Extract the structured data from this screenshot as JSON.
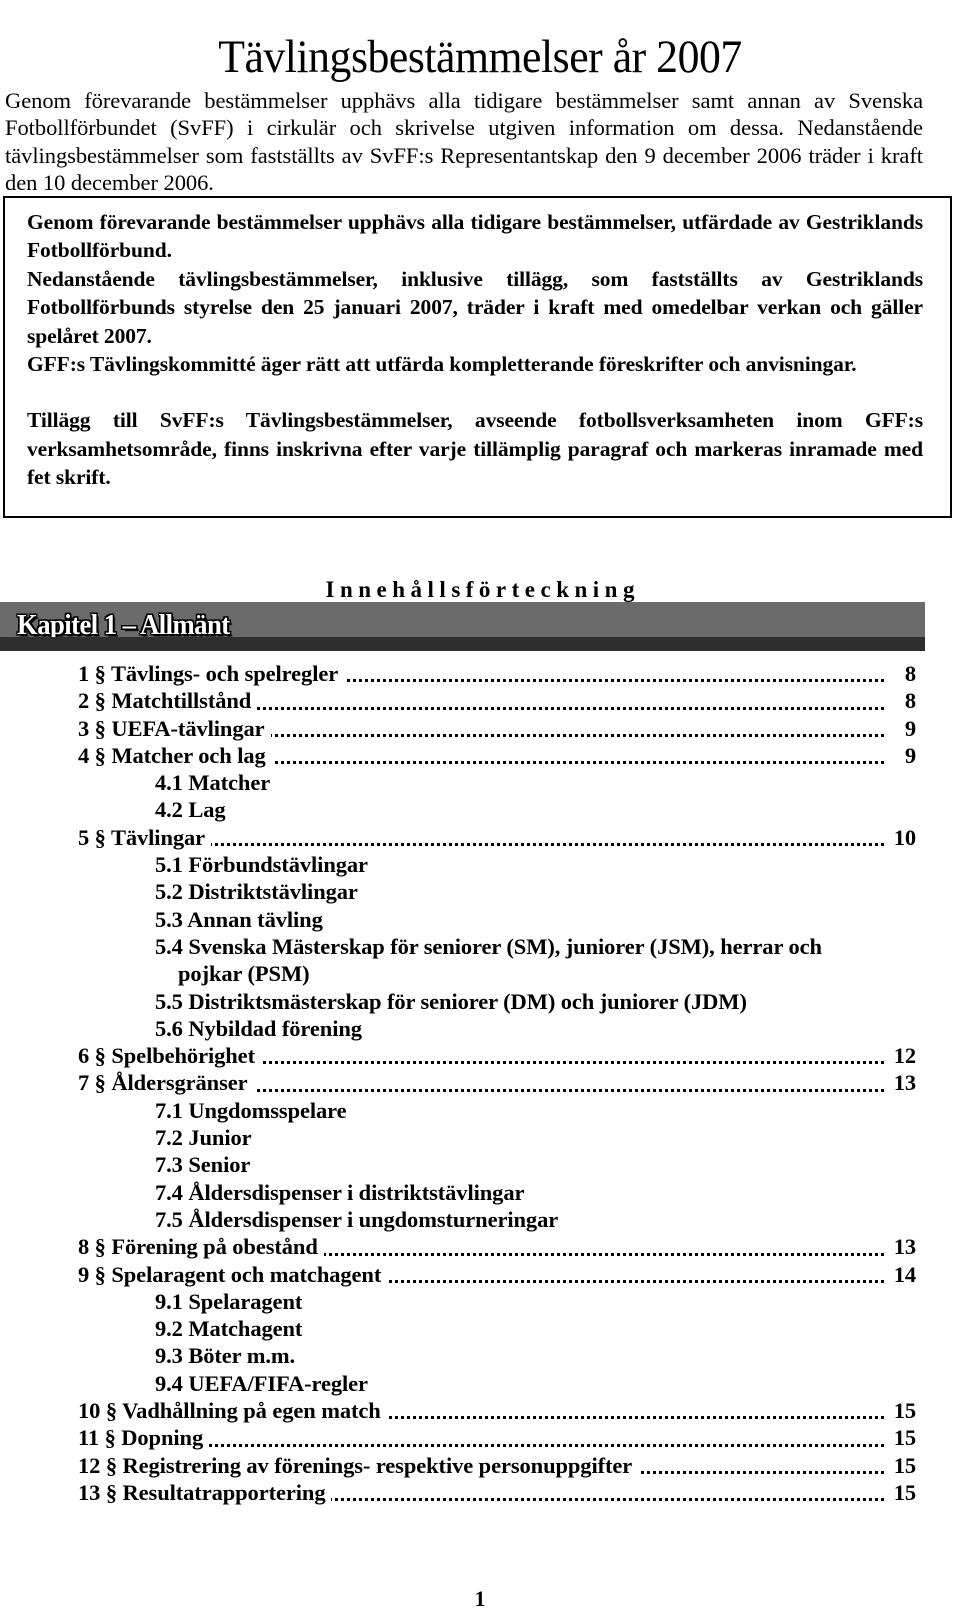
{
  "document": {
    "title": "Tävlingsbestämmelser år 2007",
    "page_number": "1"
  },
  "intro": {
    "paragraph": "Genom förevarande bestämmelser upphävs alla tidigare bestämmelser samt annan av Svenska Fotbollförbundet (SvFF) i cirkulär och skrivelse utgiven information om dessa. Nedanstående tävlingsbestämmelser som fastställts av SvFF:s Representantskap den 9 december 2006 träder i kraft den 10 december 2006."
  },
  "framed_block": {
    "paragraphs": [
      "Genom förevarande bestämmelser upphävs alla tidigare bestämmelser, utfärdade av Gestriklands Fotbollförbund.",
      "Nedanstående tävlingsbestämmelser, inklusive tillägg, som fastställts av Gestriklands Fotbollförbunds styrelse den 25 januari 2007, träder i kraft med omedelbar verkan och gäller spelåret 2007.",
      "GFF:s Tävlingskommitté äger rätt att utfärda kompletterande föreskrifter och anvisningar.",
      "Tillägg till SvFF:s Tävlingsbestämmelser, avseende fotbollsverksamheten inom GFF:s verksamhetsområde, finns inskrivna efter varje tillämplig paragraf och markeras inramade med fet skrift."
    ]
  },
  "toc": {
    "heading": "Innehållsförteckning",
    "chapter_banner": "Kapitel 1 – Allmänt",
    "banner_color": "#6b6b6b",
    "banner_band_color": "#2e2e2e",
    "entries": [
      {
        "label": "1 § Tävlings- och spelregler",
        "page": "8",
        "level": 1,
        "dots": true
      },
      {
        "label": "2 § Matchtillstånd",
        "page": "8",
        "level": 1,
        "dots": true
      },
      {
        "label": "3 § UEFA-tävlingar",
        "page": "9",
        "level": 1,
        "dots": true
      },
      {
        "label": "4 § Matcher och lag",
        "page": "9",
        "level": 1,
        "dots": true
      },
      {
        "label": "4.1 Matcher",
        "page": "",
        "level": 2,
        "dots": false
      },
      {
        "label": "4.2 Lag",
        "page": "",
        "level": 2,
        "dots": false
      },
      {
        "label": "5 § Tävlingar",
        "page": "10",
        "level": 1,
        "dots": true
      },
      {
        "label": "5.1 Förbundstävlingar",
        "page": "",
        "level": 2,
        "dots": false
      },
      {
        "label": "5.2 Distriktstävlingar",
        "page": "",
        "level": 2,
        "dots": false
      },
      {
        "label": "5.3 Annan tävling",
        "page": "",
        "level": 2,
        "dots": false
      },
      {
        "label": "5.4 Svenska Mästerskap för seniorer (SM), juniorer (JSM), herrar och",
        "label_cont": "pojkar (PSM)",
        "page": "",
        "level": 2,
        "dots": false
      },
      {
        "label": "5.5 Distriktsmästerskap för seniorer (DM) och juniorer (JDM)",
        "page": "",
        "level": 2,
        "dots": false
      },
      {
        "label": "5.6 Nybildad förening",
        "page": "",
        "level": 2,
        "dots": false
      },
      {
        "label": "6 § Spelbehörighet",
        "page": "12",
        "level": 1,
        "dots": true
      },
      {
        "label": "7 § Åldersgränser",
        "page": "13",
        "level": 1,
        "dots": true
      },
      {
        "label": "7.1 Ungdomsspelare",
        "page": "",
        "level": 2,
        "dots": false
      },
      {
        "label": "7.2 Junior",
        "page": "",
        "level": 2,
        "dots": false
      },
      {
        "label": "7.3 Senior",
        "page": "",
        "level": 2,
        "dots": false
      },
      {
        "label": "7.4 Åldersdispenser i distriktstävlingar",
        "page": "",
        "level": 2,
        "dots": false
      },
      {
        "label": "7.5 Åldersdispenser i ungdomsturneringar",
        "page": "",
        "level": 2,
        "dots": false
      },
      {
        "label": "8 § Förening på obestånd",
        "page": "13",
        "level": 1,
        "dots": true
      },
      {
        "label": "9 § Spelaragent och matchagent",
        "page": "14",
        "level": 1,
        "dots": true
      },
      {
        "label": "9.1 Spelaragent",
        "page": "",
        "level": 2,
        "dots": false
      },
      {
        "label": "9.2 Matchagent",
        "page": "",
        "level": 2,
        "dots": false
      },
      {
        "label": "9.3 Böter m.m.",
        "page": "",
        "level": 2,
        "dots": false
      },
      {
        "label": "9.4 UEFA/FIFA-regler",
        "page": "",
        "level": 2,
        "dots": false
      },
      {
        "label": "10 § Vadhållning på egen match",
        "page": "15",
        "level": 1,
        "dots": true
      },
      {
        "label": "11 § Dopning",
        "page": "15",
        "level": 1,
        "dots": true
      },
      {
        "label": "12 § Registrering av förenings- respektive personuppgifter",
        "page": "15",
        "level": 1,
        "dots": true
      },
      {
        "label": "13 § Resultatrapportering",
        "page": "15",
        "level": 1,
        "dots": true
      }
    ]
  }
}
